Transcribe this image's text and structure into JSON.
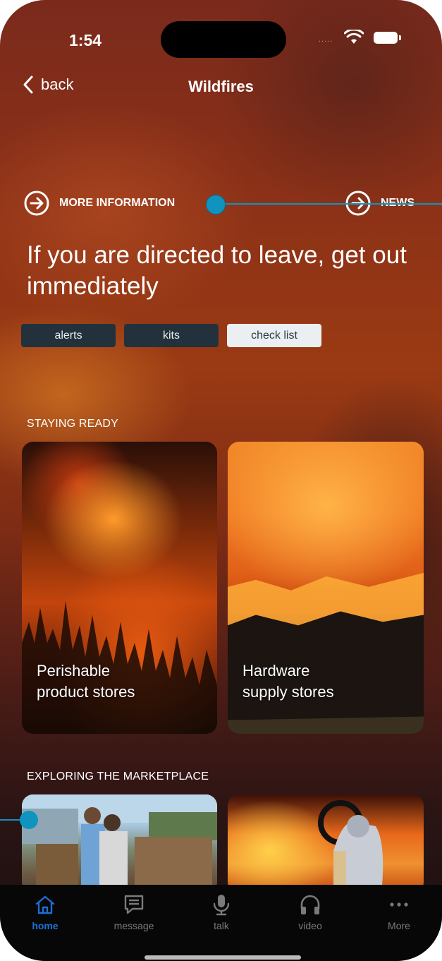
{
  "status": {
    "time": "1:54",
    "dots": "....."
  },
  "nav": {
    "back_label": "back",
    "title": "Wildfires"
  },
  "links": {
    "more_info": "MORE INFORMATION",
    "news": "NEWS"
  },
  "headline": "If you are directed to leave, get out immediately",
  "chips": [
    {
      "label": "alerts",
      "selected": false
    },
    {
      "label": "kits",
      "selected": false
    },
    {
      "label": "check list",
      "selected": true
    }
  ],
  "sections": {
    "staying_ready": {
      "title": "STAYING READY",
      "cards": [
        {
          "label_line1": "Perishable",
          "label_line2": "product stores"
        },
        {
          "label_line1": "Hardware",
          "label_line2": "supply stores"
        }
      ]
    },
    "marketplace": {
      "title": "EXPLORING THE MARKETPLACE"
    }
  },
  "tabbar": {
    "items": [
      {
        "label": "home",
        "icon": "home-icon",
        "active": true
      },
      {
        "label": "message",
        "icon": "message-icon",
        "active": false
      },
      {
        "label": "talk",
        "icon": "microphone-icon",
        "active": false
      },
      {
        "label": "video",
        "icon": "headphones-icon",
        "active": false
      },
      {
        "label": "More",
        "icon": "more-dots-icon",
        "active": false
      }
    ]
  },
  "colors": {
    "accent": "#1d6fd6",
    "hotspot": "#0f94c0",
    "chip_dark": "#22313b",
    "chip_light": "#eceff1"
  }
}
